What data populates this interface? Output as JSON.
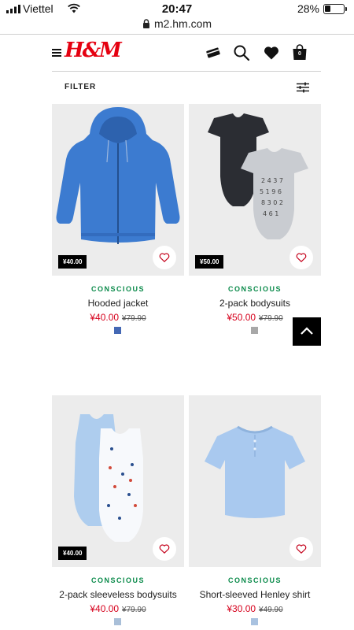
{
  "status_bar": {
    "carrier": "Viettel",
    "time": "20:47",
    "battery": "28%"
  },
  "browser": {
    "url": "m2.hm.com"
  },
  "header": {
    "logo": "H&M",
    "cart_count": "0"
  },
  "filter": {
    "label": "FILTER"
  },
  "products": [
    {
      "name": "Hooded jacket",
      "tag": "CONSCIOUS",
      "badge_price": "¥40.00",
      "price": "¥40.00",
      "old_price": "¥79.90",
      "swatch_color": "#4468b4",
      "image": "blue-hooded-jacket"
    },
    {
      "name": "2-pack bodysuits",
      "tag": "CONSCIOUS",
      "badge_price": "¥50.00",
      "price": "¥50.00",
      "old_price": "¥79.90",
      "swatch_color": "#a8a8a8",
      "image": "black-and-grey-bodysuits"
    },
    {
      "name": "2-pack sleeveless bodysuits",
      "tag": "CONSCIOUS",
      "badge_price": "¥40.00",
      "price": "¥40.00",
      "old_price": "¥79.90",
      "swatch_color": "#a9bfd8",
      "image": "light-blue-and-white-sleeveless-bodysuits"
    },
    {
      "name": "Short-sleeved Henley shirt",
      "tag": "CONSCIOUS",
      "price": "¥30.00",
      "old_price": "¥49.90",
      "swatch_color": "#a9c2e0",
      "image": "light-blue-henley-shirt"
    }
  ],
  "colors": {
    "brand": "#e50010",
    "sale_price": "#d6001c",
    "conscious": "#0a8a4a"
  }
}
